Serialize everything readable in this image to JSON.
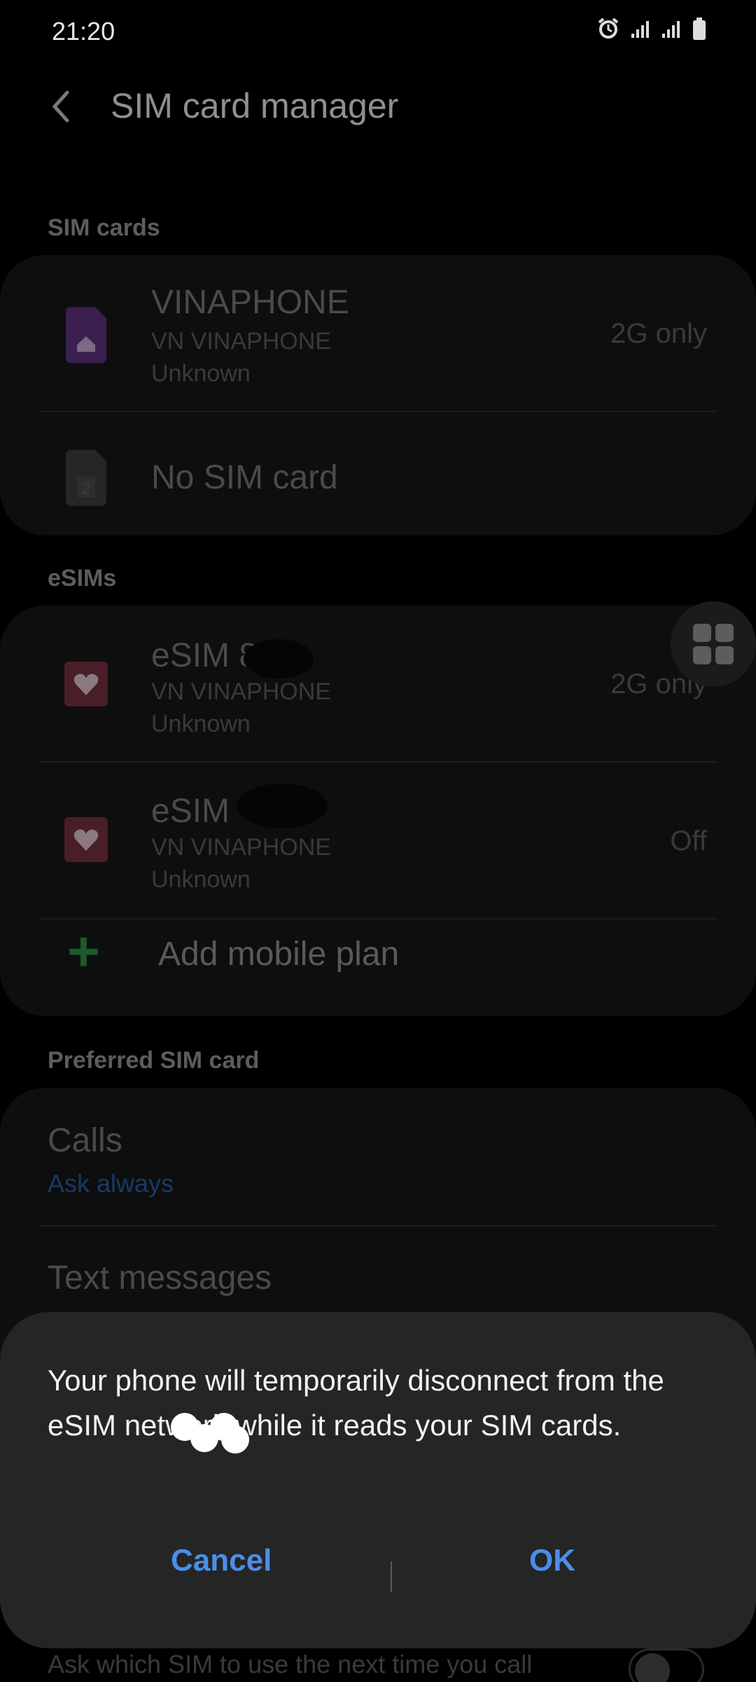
{
  "status_bar": {
    "time": "21:20",
    "icons": [
      "alarm-icon",
      "signal-icon",
      "signal-icon",
      "battery-icon"
    ]
  },
  "header": {
    "title": "SIM card manager"
  },
  "sections": {
    "sim_cards": "SIM cards",
    "esims": "eSIMs",
    "preferred": "Preferred SIM card"
  },
  "sim_cards": [
    {
      "name": "VINAPHONE",
      "network": "VN VINAPHONE",
      "status": "Unknown",
      "mode": "2G only",
      "icon": "sim1-icon"
    },
    {
      "name": "No SIM card",
      "icon": "sim2-icon"
    }
  ],
  "esims": [
    {
      "name": "eSIM 8",
      "network": "VN VINAPHONE",
      "status": "Unknown",
      "mode": "2G only",
      "icon": "esim-heart-icon"
    },
    {
      "name": "eSIM",
      "network": "VN VINAPHONE",
      "status": "Unknown",
      "mode": "Off",
      "icon": "esim-heart-icon"
    }
  ],
  "add_plan": {
    "label": "Add mobile plan"
  },
  "preferred": {
    "calls": {
      "title": "Calls",
      "value": "Ask always"
    },
    "texts": {
      "title": "Text messages"
    }
  },
  "dialog": {
    "message": "Your phone will temporarily disconnect from the eSIM  network while it reads your SIM cards.",
    "cancel": "Cancel",
    "ok": "OK"
  },
  "bottom_hint": "Ask which SIM to use the next time you call",
  "colors": {
    "accent": "#4a8fe8",
    "dialog_bg": "#252525",
    "add_plus": "#1e5a2a"
  }
}
